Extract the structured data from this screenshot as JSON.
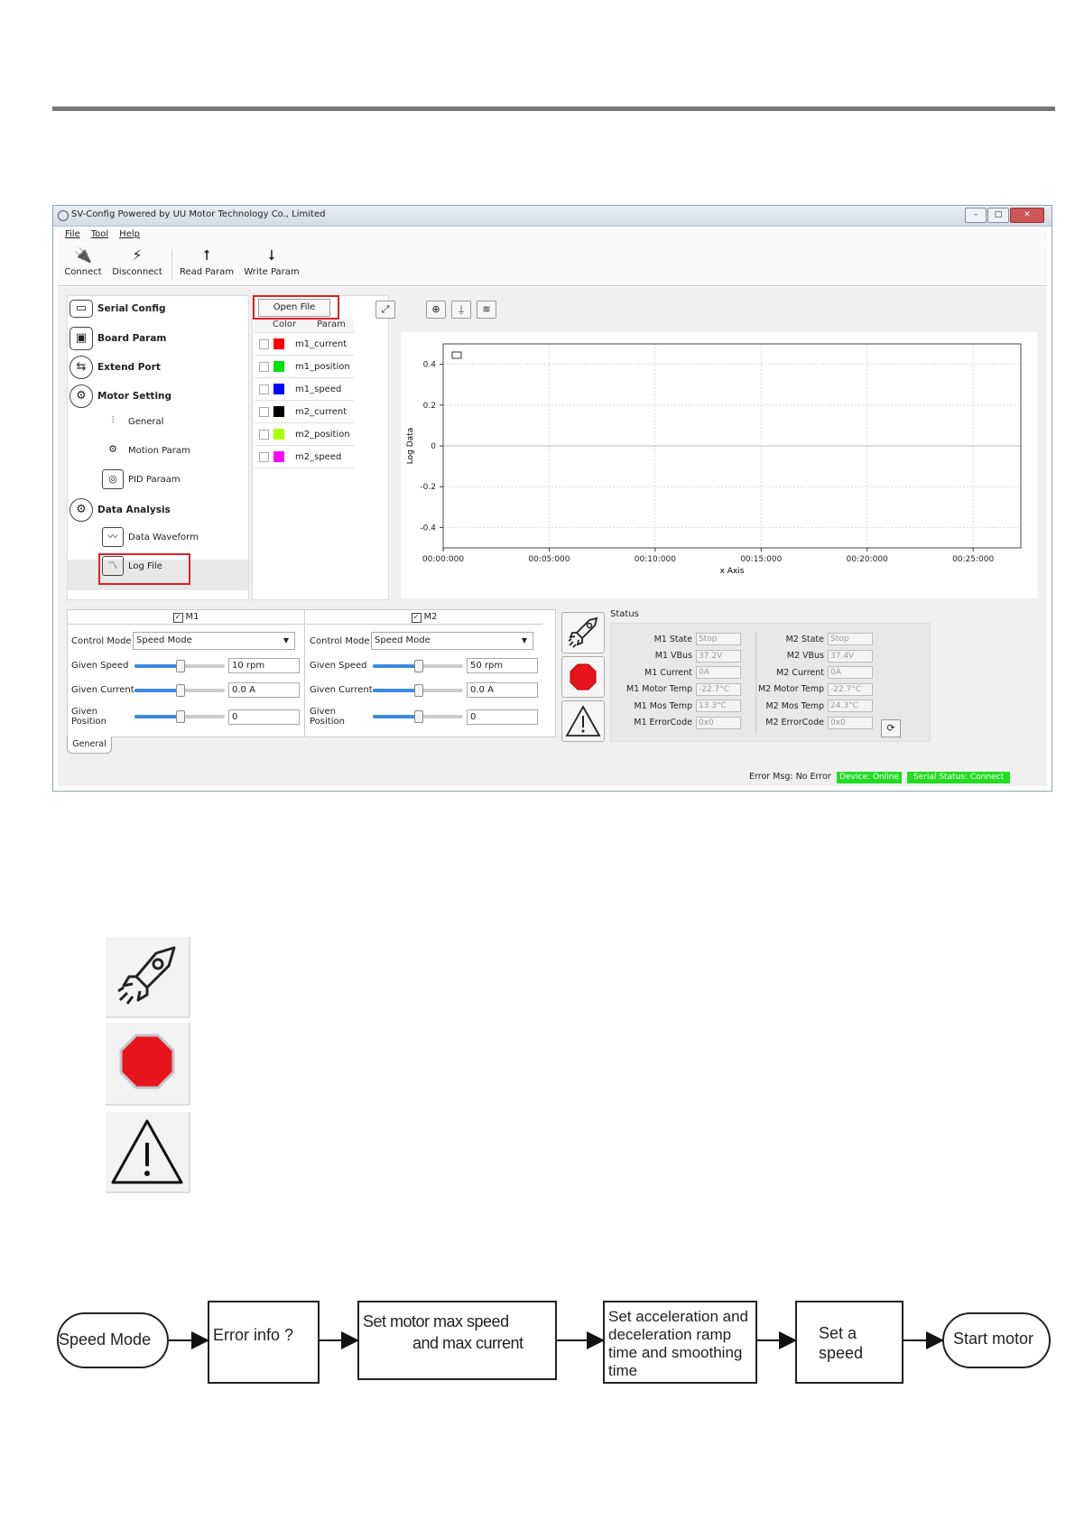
{
  "window": {
    "title": "SV-Config Powered by UU Motor Technology Co., Limited",
    "controls": [
      "minimize",
      "maximize",
      "close"
    ]
  },
  "menu": [
    "File",
    "Tool",
    "Help"
  ],
  "toolbar": {
    "connect": "Connect",
    "disconnect": "Disconnect",
    "read_param": "Read Param",
    "write_param": "Write Param"
  },
  "nav": {
    "serial_config": "Serial Config",
    "board_param": "Board Param",
    "extend_port": "Extend Port",
    "motor_setting": "Motor Setting",
    "general": "General",
    "motion_param": "Motion Param",
    "pid_param": "PID Paraam",
    "data_analysis": "Data Analysis",
    "data_waveform": "Data Waveform",
    "log_file": "Log File"
  },
  "params": {
    "open_file": "Open File",
    "col_color": "Color",
    "col_param": "Param",
    "rows": [
      {
        "name": "m1_current",
        "color": "#ff0000"
      },
      {
        "name": "m1_position",
        "color": "#00e000"
      },
      {
        "name": "m1_speed",
        "color": "#0000ff"
      },
      {
        "name": "m2_current",
        "color": "#000000"
      },
      {
        "name": "m2_position",
        "color": "#aaff00"
      },
      {
        "name": "m2_speed",
        "color": "#ff00ff"
      }
    ]
  },
  "chart_data": {
    "type": "line",
    "ylabel": "Log Data",
    "xlabel": "x Axis",
    "yticks": [
      "0.4",
      "0.2",
      "0",
      "-0.2",
      "-0.4"
    ],
    "xticks": [
      "00:00:000",
      "00:05:000",
      "00:10:000",
      "00:15:000",
      "00:20:000",
      "00:25:000"
    ],
    "ylim": [
      -0.5,
      0.5
    ],
    "grid": true,
    "series": []
  },
  "m1": {
    "title": "M1",
    "control_mode_label": "Control Mode",
    "control_mode": "Speed Mode",
    "given_speed_label": "Given Speed",
    "given_speed": "10 rpm",
    "given_current_label": "Given Current",
    "given_current": "0.0 A",
    "given_position_label": "Given Position",
    "given_position": "0"
  },
  "m2": {
    "title": "M2",
    "control_mode_label": "Control Mode",
    "control_mode": "Speed Mode",
    "given_speed_label": "Given Speed",
    "given_speed": "50 rpm",
    "given_current_label": "Given Current",
    "given_current": "0.0 A",
    "given_position_label": "Given Position",
    "given_position": "0"
  },
  "tab_general": "General",
  "status": {
    "title": "Status",
    "m1": [
      {
        "label": "M1 State",
        "value": "Stop"
      },
      {
        "label": "M1 VBus",
        "value": "37.2V"
      },
      {
        "label": "M1 Current",
        "value": "0A"
      },
      {
        "label": "M1 Motor Temp",
        "value": "-22.7°C"
      },
      {
        "label": "M1 Mos Temp",
        "value": "13.3°C"
      },
      {
        "label": "M1 ErrorCode",
        "value": "0x0"
      }
    ],
    "m2": [
      {
        "label": "M2 State",
        "value": "Stop"
      },
      {
        "label": "M2 VBus",
        "value": "37.4V"
      },
      {
        "label": "M2 Current",
        "value": "0A"
      },
      {
        "label": "M2 Motor Temp",
        "value": "-22.7°C"
      },
      {
        "label": "M2 Mos Temp",
        "value": "24.3°C"
      },
      {
        "label": "M2 ErrorCode",
        "value": "0x0"
      }
    ]
  },
  "statusbar": {
    "error_msg": "Error Msg: No Error",
    "device": "Device: Online",
    "serial": "Serial Status: Connect",
    "ok_color": "#22dd22"
  },
  "flow": {
    "n1": "Speed Mode",
    "n2": "Error info ?",
    "n3a": "Set motor max speed",
    "n3b": "and max current",
    "n4a": "Set acceleration and",
    "n4b": "deceleration ramp",
    "n4c": "time and smoothing",
    "n4d": "time",
    "n5a": "Set a",
    "n5b": "speed",
    "n6": "Start motor"
  }
}
